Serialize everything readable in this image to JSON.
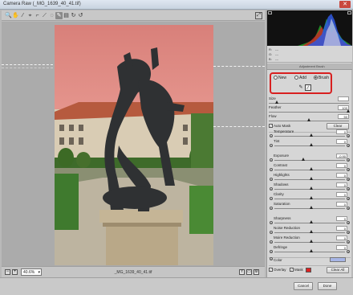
{
  "window": {
    "title": "Camera Raw (_MG_1639_40_41.tif)"
  },
  "toolbar": {
    "tools": [
      {
        "name": "zoom-icon",
        "glyph": "🔍"
      },
      {
        "name": "hand-icon",
        "glyph": "✋"
      },
      {
        "name": "white-balance-icon",
        "glyph": "⁄"
      },
      {
        "name": "color-sampler-icon",
        "glyph": "⌖"
      },
      {
        "name": "crop-icon",
        "glyph": "⌐"
      },
      {
        "name": "straighten-icon",
        "glyph": "⟋"
      },
      {
        "name": "spot-removal-icon",
        "glyph": "◌"
      },
      {
        "name": "adjustment-brush-icon",
        "glyph": "✎"
      },
      {
        "name": "graduated-filter-icon",
        "glyph": "▤"
      },
      {
        "name": "rotate-icon",
        "glyph": "↻"
      },
      {
        "name": "rotate-ccw-icon",
        "glyph": "↺"
      }
    ]
  },
  "bottom": {
    "zoom": "40.6%",
    "filename": "_MG_1639_40_41.tif"
  },
  "panel": {
    "readout": {
      "r": "R:",
      "g": "G:",
      "b": "B:",
      "r_val": "---",
      "g_val": "---",
      "b_val": "---"
    },
    "header": "Adjustment Brush",
    "modes": {
      "new": "New",
      "add": "Add",
      "erase": "Brush"
    },
    "size": {
      "label": "Size",
      "value": ""
    },
    "feather": {
      "label": "Feather",
      "value": "100"
    },
    "flow": {
      "label": "Flow",
      "value": "50"
    },
    "automask": "Auto Mask",
    "clear": "Clear",
    "adjust": [
      {
        "label": "Temperature",
        "value": "0",
        "pos": 0.5
      },
      {
        "label": "Tint",
        "value": "0",
        "pos": 0.5
      },
      {
        "label": "Exposure",
        "value": "-0.90",
        "pos": 0.39
      },
      {
        "label": "Contrast",
        "value": "0",
        "pos": 0.5
      },
      {
        "label": "Highlights",
        "value": "0",
        "pos": 0.5
      },
      {
        "label": "Shadows",
        "value": "0",
        "pos": 0.5
      },
      {
        "label": "Clarity",
        "value": "0",
        "pos": 0.5
      },
      {
        "label": "Saturation",
        "value": "0",
        "pos": 0.5
      },
      {
        "label": "Sharpness",
        "value": "0",
        "pos": 0.5
      },
      {
        "label": "Noise Reduction",
        "value": "0",
        "pos": 0.5
      },
      {
        "label": "Moire Reduction",
        "value": "0",
        "pos": 0.5
      },
      {
        "label": "Defringe",
        "value": "0",
        "pos": 0.5
      }
    ],
    "color_label": "Color",
    "color": "#a7b5e6",
    "overlay": "Overlay",
    "mask": "Mask",
    "mask_color": "#e02020",
    "clear_all": "Clear All"
  },
  "footer": {
    "cancel": "Cancel",
    "done": "Done"
  }
}
